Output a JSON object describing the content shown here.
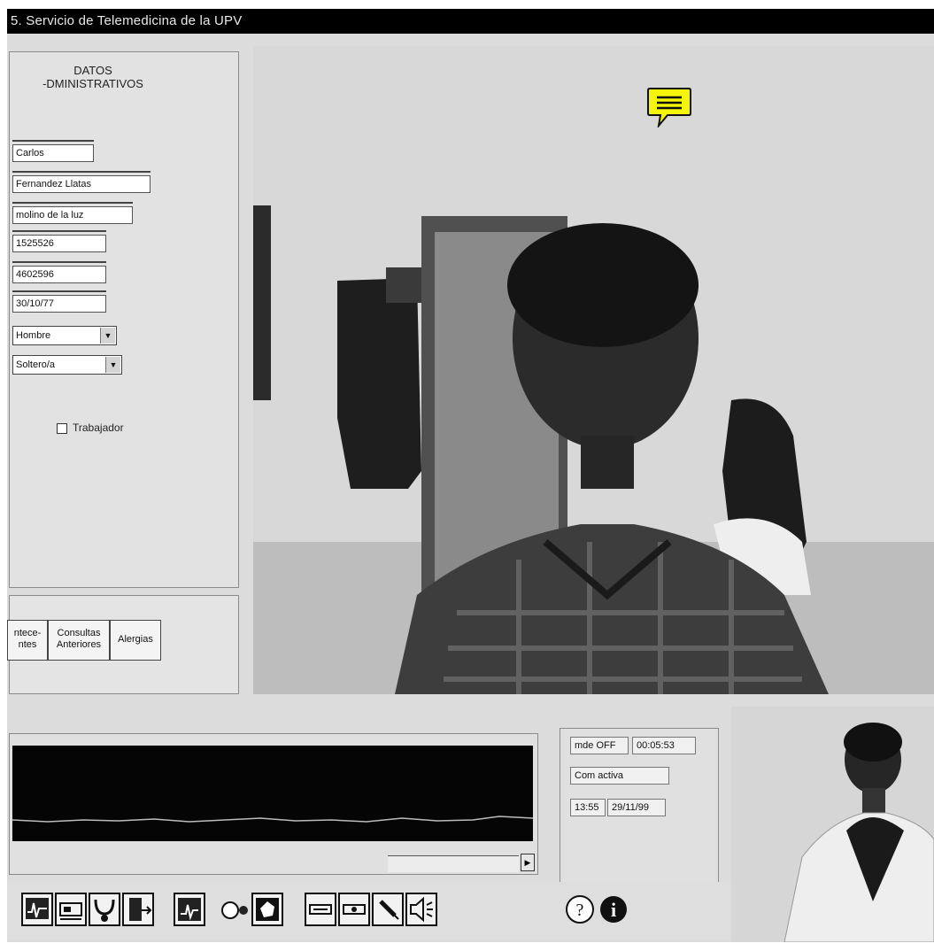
{
  "window": {
    "title": "5. Servicio de Telemedicina de la UPV"
  },
  "admin": {
    "title_line1": "DATOS",
    "title_line2": "-DMINISTRATIVOS",
    "fields": {
      "nombre": "Carlos",
      "apellidos": "Fernandez Llatas",
      "direccion": "molino de la luz",
      "campo_4": "1525526",
      "campo_5": "4602596",
      "fecha": "30/10/77"
    },
    "sexo_selected": "Hombre",
    "estado_civil_selected": "Soltero/a",
    "trabajador_label": "Trabajador",
    "trabajador_checked": false
  },
  "tabs": [
    {
      "line1": "ntece-",
      "line2": "ntes"
    },
    {
      "line1": "Consultas",
      "line2": "Anteriores"
    },
    {
      "line1": "Alergias",
      "line2": ""
    }
  ],
  "status": {
    "mode": "mde OFF",
    "timer": "00:05:53",
    "connection": "Com activa",
    "time": "13:55",
    "date": "29/11/99"
  },
  "toolbar": {
    "icons": [
      "ecg-record-icon",
      "network-card-icon",
      "stethoscope-icon",
      "exit-door-icon",
      "ecg-view-icon",
      "camera-icon",
      "snapshot-icon",
      "send-data-icon",
      "receive-data-icon",
      "microphone-icon",
      "speaker-icon",
      "help-icon",
      "info-icon"
    ]
  },
  "colors": {
    "titlebar": "#000000",
    "chat_bubble": "#f5f50a",
    "ecg_background": "#050505"
  }
}
